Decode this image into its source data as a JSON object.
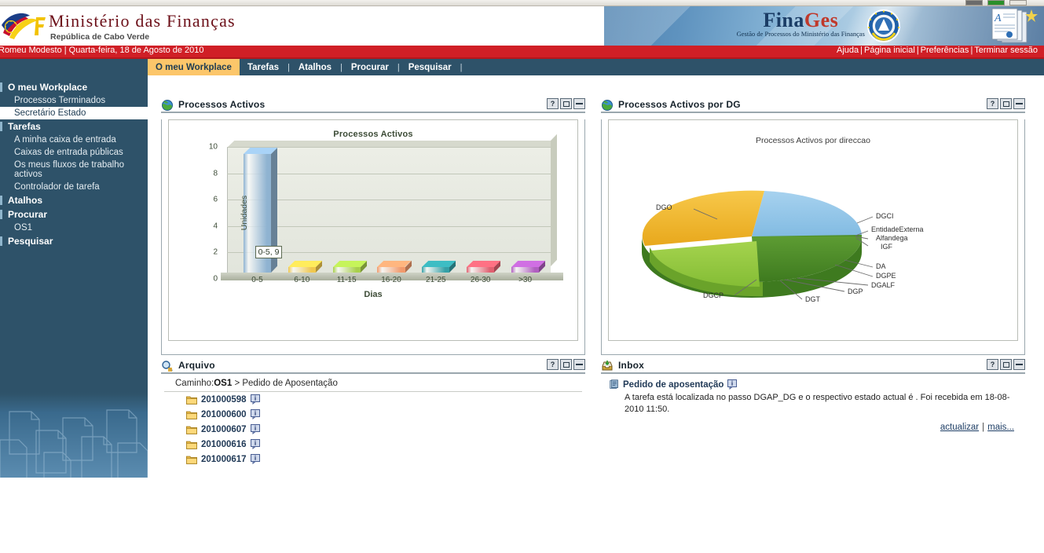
{
  "app": {
    "ministry_title": "Ministério das Finanças",
    "ministry_subtitle": "República de Cabo Verde",
    "brand_fina": "Fina",
    "brand_ges": "Ges",
    "brand_tagline": "Gestão de Processos do Ministério das Finanças"
  },
  "userbar": {
    "user_and_date": "Romeu Modesto | Quarta-feira, 18 de Agosto de 2010",
    "links": [
      "Ajuda",
      "Página inicial",
      "Preferências",
      "Terminar sessão"
    ]
  },
  "tabs": [
    {
      "label": "O meu Workplace",
      "active": true
    },
    {
      "label": "Tarefas",
      "active": false
    },
    {
      "label": "Atalhos",
      "active": false
    },
    {
      "label": "Procurar",
      "active": false
    },
    {
      "label": "Pesquisar",
      "active": false
    }
  ],
  "sidebar": {
    "nodes": [
      {
        "label": "O meu Workplace",
        "type": "group"
      },
      {
        "label": "Processos Terminados",
        "type": "item",
        "selected": false
      },
      {
        "label": "Secretário Estado",
        "type": "item",
        "selected": true
      },
      {
        "label": "Tarefas",
        "type": "group"
      },
      {
        "label": "A minha caixa de entrada",
        "type": "item",
        "selected": false
      },
      {
        "label": "Caixas de entrada públicas",
        "type": "item",
        "selected": false
      },
      {
        "label": "Os meus fluxos de trabalho activos",
        "type": "item",
        "selected": false
      },
      {
        "label": "Controlador de tarefa",
        "type": "item",
        "selected": false
      },
      {
        "label": "Atalhos",
        "type": "group"
      },
      {
        "label": "Procurar",
        "type": "group"
      },
      {
        "label": "OS1",
        "type": "item",
        "selected": false
      },
      {
        "label": "Pesquisar",
        "type": "group"
      }
    ]
  },
  "portlets": {
    "processos_activos": {
      "title": "Processos Activos",
      "help_label": "?",
      "maximize_label": "maximizar",
      "minimize_label": "minimizar"
    },
    "processos_por_dg": {
      "title": "Processos Activos por DG",
      "help_label": "?",
      "maximize_label": "maximizar",
      "minimize_label": "minimizar"
    },
    "arquivo": {
      "title": "Arquivo",
      "help_label": "?",
      "maximize_label": "maximizar",
      "minimize_label": "minimizar",
      "path_prefix": "Caminho:",
      "path_root": "OS1",
      "path_sep": ">",
      "path_leaf": "Pedido de Aposentação",
      "files": [
        "201000598",
        "201000600",
        "201000607",
        "201000616",
        "201000617"
      ]
    },
    "inbox": {
      "title": "Inbox",
      "help_label": "?",
      "maximize_label": "maximizar",
      "minimize_label": "minimizar",
      "item_title": "Pedido de aposentação",
      "item_text": "A tarefa está localizada no passo DGAP_DG e o respectivo estado actual é . Foi recebida em 18-08-2010 11:50.",
      "link_refresh": "actualizar",
      "link_more": "mais...",
      "link_sep": "|"
    }
  },
  "chart_data": [
    {
      "type": "bar",
      "title": "Processos Activos",
      "xlabel": "Dias",
      "ylabel": "Unidades",
      "categories": [
        "0-5",
        "6-10",
        "11-15",
        "16-20",
        "21-25",
        "26-30",
        ">30"
      ],
      "values": [
        9,
        0,
        0,
        0,
        0,
        0,
        0
      ],
      "yticks": [
        0,
        2,
        4,
        6,
        8,
        10
      ],
      "ylim": [
        0,
        10
      ],
      "grid": true,
      "legend": "none",
      "annotation": "0-5, 9",
      "colors": [
        "#8fb3d1",
        "#f0c84e",
        "#a8cf4c",
        "#f19a6c",
        "#34a0a6",
        "#e06070",
        "#b05ec0"
      ]
    },
    {
      "type": "pie",
      "title": "Processos Activos por direccao",
      "labels": [
        "DGO",
        "DGCI",
        "EntidadeExterna",
        "Alfandega",
        "IGF",
        "DA",
        "DGPE",
        "DGALF",
        "DGP",
        "DGT",
        "DGCP"
      ],
      "values": [
        33,
        22,
        0.4,
        0.4,
        0.4,
        22,
        0.4,
        0.4,
        0.4,
        0.4,
        20
      ],
      "colors": [
        "#efb42e",
        "#8ec3e8",
        "#4f8f2a",
        "#4f8f2a",
        "#4f8f2a",
        "#4f8f2a",
        "#4f8f2a",
        "#4f8f2a",
        "#4f8f2a",
        "#8dc63f",
        "#8dc63f"
      ],
      "legend": "labels-with-leader-lines"
    }
  ],
  "theme": {
    "nav_blue": "#2e5269",
    "accent_red": "#d01f26",
    "tab_active": "#fcc66a",
    "link_blue": "#213a57"
  }
}
